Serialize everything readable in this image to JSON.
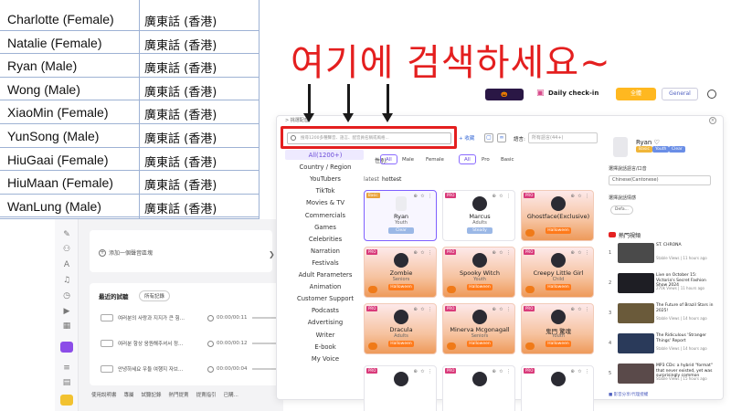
{
  "overlay": {
    "caption": "여기에 검색하세요~"
  },
  "voice_table": {
    "rows": [
      {
        "name": "Charlotte (Female)",
        "lang": "廣東話 (香港)"
      },
      {
        "name": "Natalie (Female)",
        "lang": "廣東話 (香港)"
      },
      {
        "name": "Ryan (Male)",
        "lang": "廣東話 (香港)"
      },
      {
        "name": "Wong (Male)",
        "lang": "廣東話 (香港)"
      },
      {
        "name": "XiaoMin (Female)",
        "lang": "廣東話 (香港)"
      },
      {
        "name": "YunSong (Male)",
        "lang": "廣東話 (香港)"
      },
      {
        "name": "HiuGaai (Female)",
        "lang": "廣東話 (香港)"
      },
      {
        "name": "HiuMaan (Female)",
        "lang": "廣東話 (香港)"
      },
      {
        "name": "WanLung (Male)",
        "lang": "廣東話 (香港)"
      }
    ]
  },
  "header": {
    "checkin": "Daily check-in",
    "gold_btn": "全體",
    "general_btn": "General"
  },
  "dialog": {
    "breadcrumb": "> 挑選配音",
    "search_placeholder": "搜尋1200多種聲音、語言、配音員名稱或風格...",
    "toolbar_link": "+ 收藏",
    "lang_label": "語言:",
    "lang_placeholder": "所有語言(44+)",
    "categories": [
      "All(1200+)",
      "Country / Region",
      "YouTubers",
      "TikTok",
      "Movies & TV",
      "Commercials",
      "Games",
      "Celebrities",
      "Narration",
      "Festivals",
      "Adult Parameters",
      "Animation",
      "Customer Support",
      "Podcasts",
      "Advertising",
      "Writer",
      "E-book",
      "My Voice"
    ],
    "filters": {
      "gender_label": "性別:",
      "gender": [
        "All",
        "Male",
        "Female"
      ],
      "tier": [
        "All",
        "Pro",
        "Basic"
      ]
    },
    "sort": [
      "latest",
      "hottest"
    ],
    "cards": [
      {
        "name": "Ryan",
        "desc": "Youth",
        "tag": "Clear",
        "badge": "Basic",
        "style": "mic"
      },
      {
        "name": "Marcus",
        "desc": "Adults",
        "tag": "Steady",
        "badge": "PRO",
        "style": "plain"
      },
      {
        "name": "Ghostface(Exclusive)",
        "desc": "",
        "tag": "Halloween",
        "badge": "PRO",
        "style": "hw"
      },
      {
        "name": "Zombie",
        "desc": "Seniors",
        "tag": "Halloween",
        "badge": "PRO",
        "style": "hw"
      },
      {
        "name": "Spooky Witch",
        "desc": "Youth",
        "tag": "Halloween",
        "badge": "PRO",
        "style": "hw"
      },
      {
        "name": "Creepy Little Girl",
        "desc": "Child",
        "tag": "Halloween",
        "badge": "PRO",
        "style": "hw"
      },
      {
        "name": "Dracula",
        "desc": "Adults",
        "tag": "Halloween",
        "badge": "PRO",
        "style": "hw"
      },
      {
        "name": "Minerva Mcgonagall",
        "desc": "Seniors",
        "tag": "Halloween",
        "badge": "PRO",
        "style": "hw"
      },
      {
        "name": "鬼門 驚魂",
        "desc": "Youth",
        "tag": "Halloween",
        "badge": "PRO",
        "style": "hw"
      },
      {
        "name": "",
        "desc": "",
        "tag": "",
        "badge": "PRO",
        "style": "plain"
      },
      {
        "name": "",
        "desc": "",
        "tag": "",
        "badge": "PRO",
        "style": "plain"
      },
      {
        "name": "",
        "desc": "",
        "tag": "",
        "badge": "PRO",
        "style": "plain"
      }
    ]
  },
  "right_panel": {
    "name": "Ryan ♡",
    "tags": [
      "Basic",
      "Youth",
      "Clear"
    ],
    "lang_label": "選擇說話語言/口音",
    "lang_value": "Chinese(Cantonese)",
    "emotion_label": "選擇說話情感",
    "emotion_value": "Defa...",
    "hot_label": "熱門視頻",
    "videos": [
      {
        "num": "1",
        "title": "ST. CHRONA",
        "meta": "Stable Views | 11 hours ago"
      },
      {
        "num": "2",
        "title": "Live on October 15: Victoria's Secret Fashion Show 2024",
        "meta": "270k Views | 11 hours ago"
      },
      {
        "num": "3",
        "title": "The Future of Brazil Stars in 2025!",
        "meta": "Stable Views | 14 hours ago"
      },
      {
        "num": "4",
        "title": "The Ridiculous 'Stranger Things' Report",
        "meta": "Stable Views | 14 hours ago"
      },
      {
        "num": "5",
        "title": "MP3 CDs: a hybrid \"format\" that never existed, yet was surprisingly common",
        "meta": "Stable Views | 15 hours ago"
      }
    ],
    "footer": "■ 影音分享/代理授權"
  },
  "background_app": {
    "add_sample": "添加一個聲音區塊",
    "recent_title": "最近的試聽",
    "recent_tab": "所有記錄",
    "recent_rows": [
      {
        "text": "여러분의 사랑과 지지가 큰 힘...",
        "time": "00:00/00:11"
      },
      {
        "text": "여러분 항상 응원해주셔서 정...",
        "time": "00:00/00:12"
      },
      {
        "text": "안녕하세요 우들 여행지 자브...",
        "time": "00:00/00:04"
      }
    ],
    "bottom_links": [
      "使用說明書",
      "專屬",
      "試聽記錄",
      "熱門提賣",
      "提賣指引",
      "已購..."
    ]
  },
  "colors": {
    "accent": "#6a4ad8",
    "annotation": "#e41f1f",
    "halloween": "#ff7a1a"
  }
}
